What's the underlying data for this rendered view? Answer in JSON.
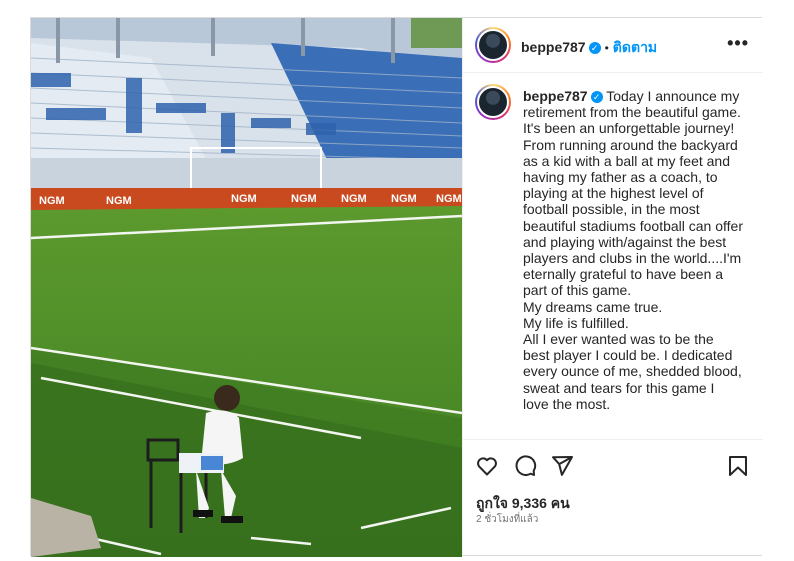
{
  "post": {
    "username": "beppe787",
    "verified_mark": "✓",
    "separator": "•",
    "follow_label": "ติดตาม",
    "more_label": "•••",
    "caption_paragraphs": [
      "Today I announce my retirement from the beautiful game.",
      "It's been an unforgettable journey! From running around the backyard as a kid with a ball at my feet and having my father as a coach, to playing at the highest level of football possible, in the most beautiful stadiums football can offer and playing with/against the best players and clubs in the world....I'm eternally grateful to have been a part of this game.",
      "My dreams came true.",
      "My life is fulfilled.",
      "All I ever wanted was to be the best player I could be. I dedicated every ounce of me, shedded blood, sweat and tears for this game I love the most."
    ],
    "likes_text": "ถูกใจ 9,336 คน",
    "time_text": "2 ชั่วโมงที่แล้ว"
  },
  "photo": {
    "sponsor_text": "NGM",
    "description_icon": "stadium-photo"
  },
  "icons": {
    "like": "heart-icon",
    "comment": "comment-icon",
    "share": "share-icon",
    "save": "bookmark-icon",
    "more": "more-icon"
  },
  "colors": {
    "accent": "#0095f6",
    "text": "#262626",
    "muted": "#737373",
    "border": "#dbdbdb"
  }
}
